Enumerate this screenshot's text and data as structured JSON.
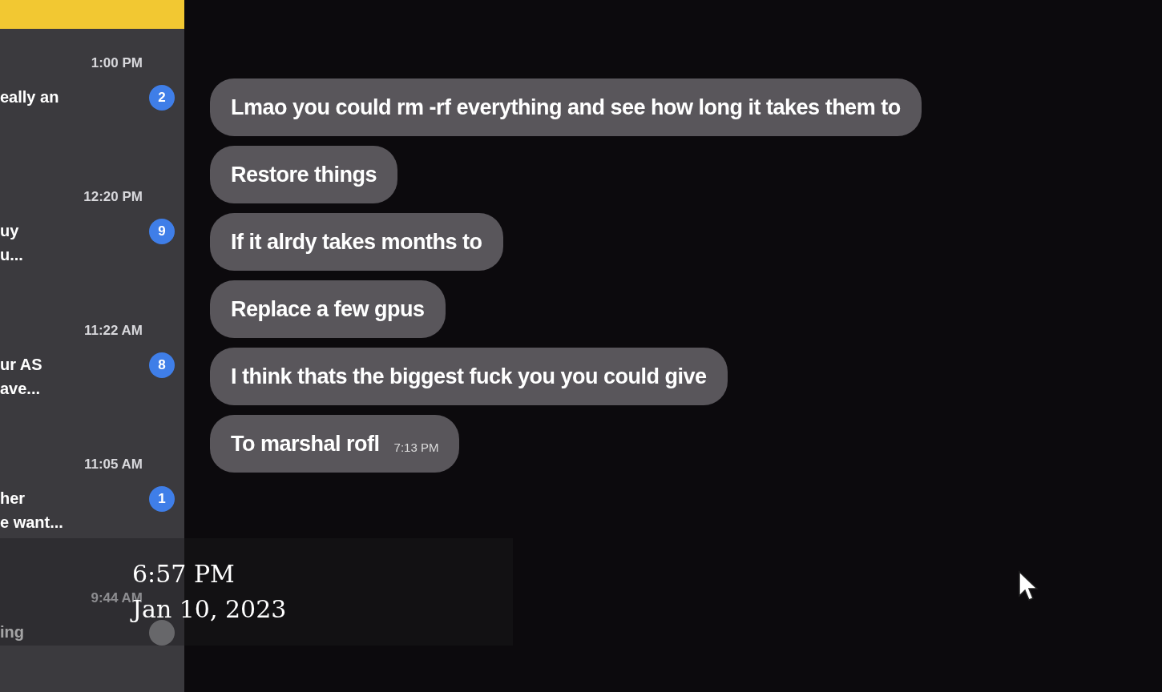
{
  "sidebar": {
    "conversations": [
      {
        "time": "1:00 PM",
        "preview": [
          "eally an"
        ],
        "badge": "2",
        "unread": true
      },
      {
        "time": "12:20 PM",
        "preview": [
          "uy",
          "u..."
        ],
        "badge": "9",
        "unread": true
      },
      {
        "time": "11:22 AM",
        "preview": [
          "ur AS",
          "ave..."
        ],
        "badge": "8",
        "unread": true
      },
      {
        "time": "11:05 AM",
        "preview": [
          "her",
          "e want..."
        ],
        "badge": "1",
        "unread": true
      },
      {
        "time": "9:44 AM",
        "preview": [
          "ing"
        ],
        "unread": false
      }
    ]
  },
  "messages": [
    {
      "text": "Lmao you could rm -rf everything and see how long it takes them to"
    },
    {
      "text": "Restore things"
    },
    {
      "text": "If it alrdy takes months to"
    },
    {
      "text": "Replace a few gpus"
    },
    {
      "text": "I think thats the biggest fuck you you could give"
    },
    {
      "text": "To marshal rofl",
      "time": "7:13 PM"
    }
  ],
  "overlay": {
    "time": "6:57 PM",
    "date": "Jan 10, 2023"
  }
}
